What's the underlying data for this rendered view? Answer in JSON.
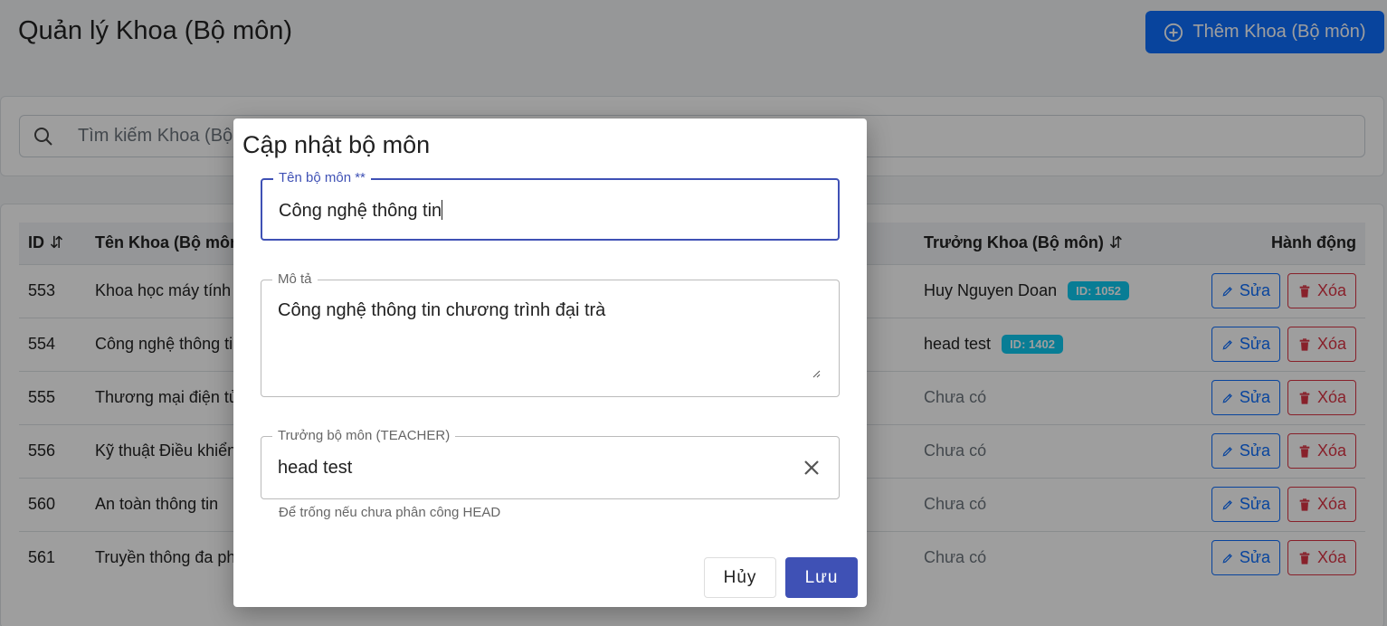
{
  "page": {
    "title": "Quản lý Khoa (Bộ môn)",
    "add_button": "Thêm Khoa (Bộ môn)",
    "search_placeholder": "Tìm kiếm Khoa (Bộ môn)..."
  },
  "table": {
    "headers": {
      "id": "ID",
      "name": "Tên Khoa (Bộ môn)",
      "head": "Trưởng Khoa (Bộ môn)",
      "actions": "Hành động"
    },
    "edit_label": "Sửa",
    "delete_label": "Xóa",
    "rows": [
      {
        "id": "553",
        "name": "Khoa học máy tính",
        "head": "Huy Nguyen Doan",
        "badge": "ID: 1052"
      },
      {
        "id": "554",
        "name": "Công nghệ thông tin",
        "head": "head test",
        "badge": "ID: 1402"
      },
      {
        "id": "555",
        "name": "Thương mại điện tử",
        "head": "Chưa có",
        "badge": ""
      },
      {
        "id": "556",
        "name": "Kỹ thuật Điều khiển",
        "head": "Chưa có",
        "badge": ""
      },
      {
        "id": "560",
        "name": "An toàn thông tin",
        "head": "Chưa có",
        "badge": ""
      },
      {
        "id": "561",
        "name": "Truyền thông đa phương tiện",
        "head": "Chưa có",
        "badge": ""
      }
    ]
  },
  "dialog": {
    "title": "Cập nhật bộ môn",
    "name_label": "Tên bộ môn **",
    "name_value": "Công nghệ thông tin",
    "desc_label": "Mô tả",
    "desc_value": "Công nghệ thông tin chương trình đại trà",
    "head_label": "Trưởng bộ môn (TEACHER)",
    "head_value": "head test",
    "head_helper": "Để trống nếu chưa phân công HEAD",
    "cancel_label": "Hủy",
    "save_label": "Lưu"
  },
  "colors": {
    "primary": "#0d6efd",
    "dialog_accent": "#3f51b5",
    "danger": "#dc3545",
    "badge": "#0dcaf0"
  }
}
